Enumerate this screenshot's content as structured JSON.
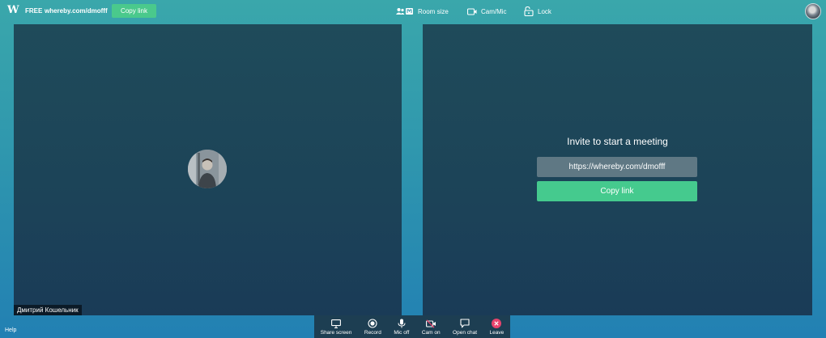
{
  "app": {
    "logo": "W",
    "plan": "FREE",
    "room_url": "whereby.com/dmofff",
    "copy_link_label": "Copy link"
  },
  "toolbar": {
    "room_size": "Room size",
    "cam_mic": "Cam/Mic",
    "lock": "Lock"
  },
  "self_tile": {
    "participant_name": "Дмитрий Кошельник"
  },
  "invite": {
    "title": "Invite to start a meeting",
    "link": "https://whereby.com/dmofff",
    "copy_label": "Copy link"
  },
  "footer": {
    "help": "Help"
  },
  "controls": {
    "share_screen": "Share screen",
    "record": "Record",
    "mic": "Mic off",
    "cam": "Cam on",
    "chat": "Open chat",
    "leave": "Leave"
  },
  "icons": [
    "room-size-icon",
    "camera-icon",
    "lock-icon",
    "monitor-icon",
    "record-icon",
    "microphone-icon",
    "camera-off-icon",
    "chat-icon",
    "close-icon"
  ],
  "colors": {
    "accent_green": "#45ca8e",
    "leave_red": "#e8436d",
    "tile_bg": "#1c4358",
    "controls_bg": "#1d3e52"
  }
}
